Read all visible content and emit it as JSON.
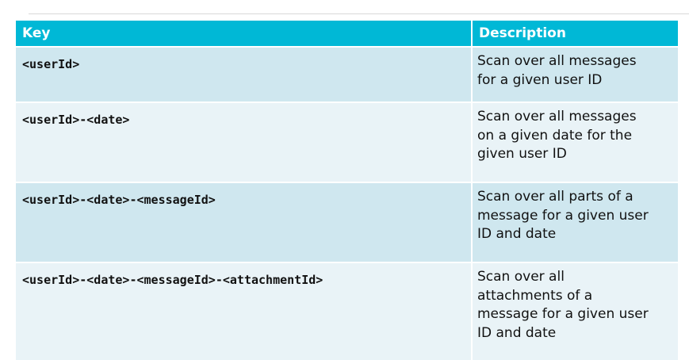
{
  "table": {
    "headers": {
      "key": "Key",
      "description": "Description"
    },
    "rows": [
      {
        "key": "<userId>",
        "description": [
          "Scan over all messages",
          "for a given user ID"
        ]
      },
      {
        "key": "<userId>-<date>",
        "description": [
          "Scan over all messages",
          "on a given date for the",
          "given user ID"
        ]
      },
      {
        "key": "<userId>-<date>-<messageId>",
        "description": [
          "Scan over all parts of a",
          "message for a given user",
          "ID and date"
        ]
      },
      {
        "key": "<userId>-<date>-<messageId>-<attachmentId>",
        "description": [
          "Scan over all",
          "attachments of a",
          "message for a given user",
          "ID and date"
        ]
      }
    ],
    "colors": {
      "header_bg": "#00b8d6",
      "band_a": "#cfe7ef",
      "band_b": "#e9f3f7"
    }
  }
}
